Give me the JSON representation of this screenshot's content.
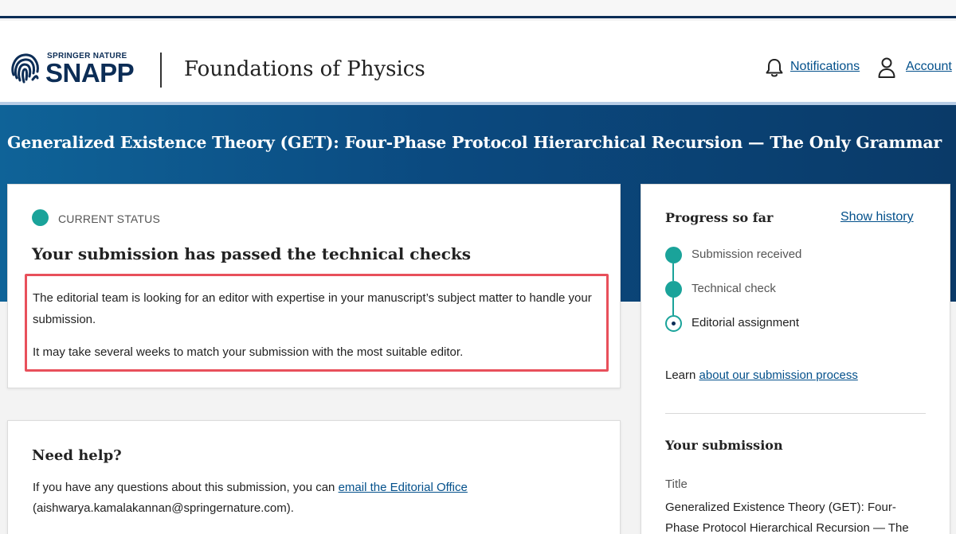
{
  "brand": {
    "logo_top": "SPRINGER NATURE",
    "logo_main": "SNAPP",
    "accent": "#0c2d56",
    "teal": "#1aa39a",
    "link": "#03508b"
  },
  "header": {
    "journal": "Foundations of Physics",
    "notifications_label": "Notifications",
    "account_label": "Account"
  },
  "banner": {
    "title": "Generalized Existence Theory (GET): Four-Phase Protocol Hierarchical Recursion — The Only Grammar"
  },
  "status": {
    "label": "CURRENT STATUS",
    "heading": "Your submission has passed the technical checks",
    "paragraph1": "The editorial team is looking for an editor with expertise in your manuscript’s subject matter to handle your submission.",
    "paragraph2": "It may take several weeks to match your submission with the most suitable editor."
  },
  "help": {
    "heading": "Need help?",
    "text_before": "If you have any questions about this submission, you can ",
    "link_text": "email the Editorial Office",
    "text_after": "(aishwarya.kamalakannan@springernature.com)."
  },
  "progress": {
    "heading": "Progress so far",
    "show_history": "Show history",
    "steps": [
      {
        "label": "Submission received",
        "state": "done"
      },
      {
        "label": "Technical check",
        "state": "done"
      },
      {
        "label": "Editorial assignment",
        "state": "current"
      }
    ],
    "learn_prefix": "Learn ",
    "learn_link": "about our submission process"
  },
  "submission": {
    "heading": "Your submission",
    "title_label": "Title",
    "title_value": "Generalized Existence Theory (GET): Four-Phase Protocol Hierarchical Recursion — The"
  }
}
